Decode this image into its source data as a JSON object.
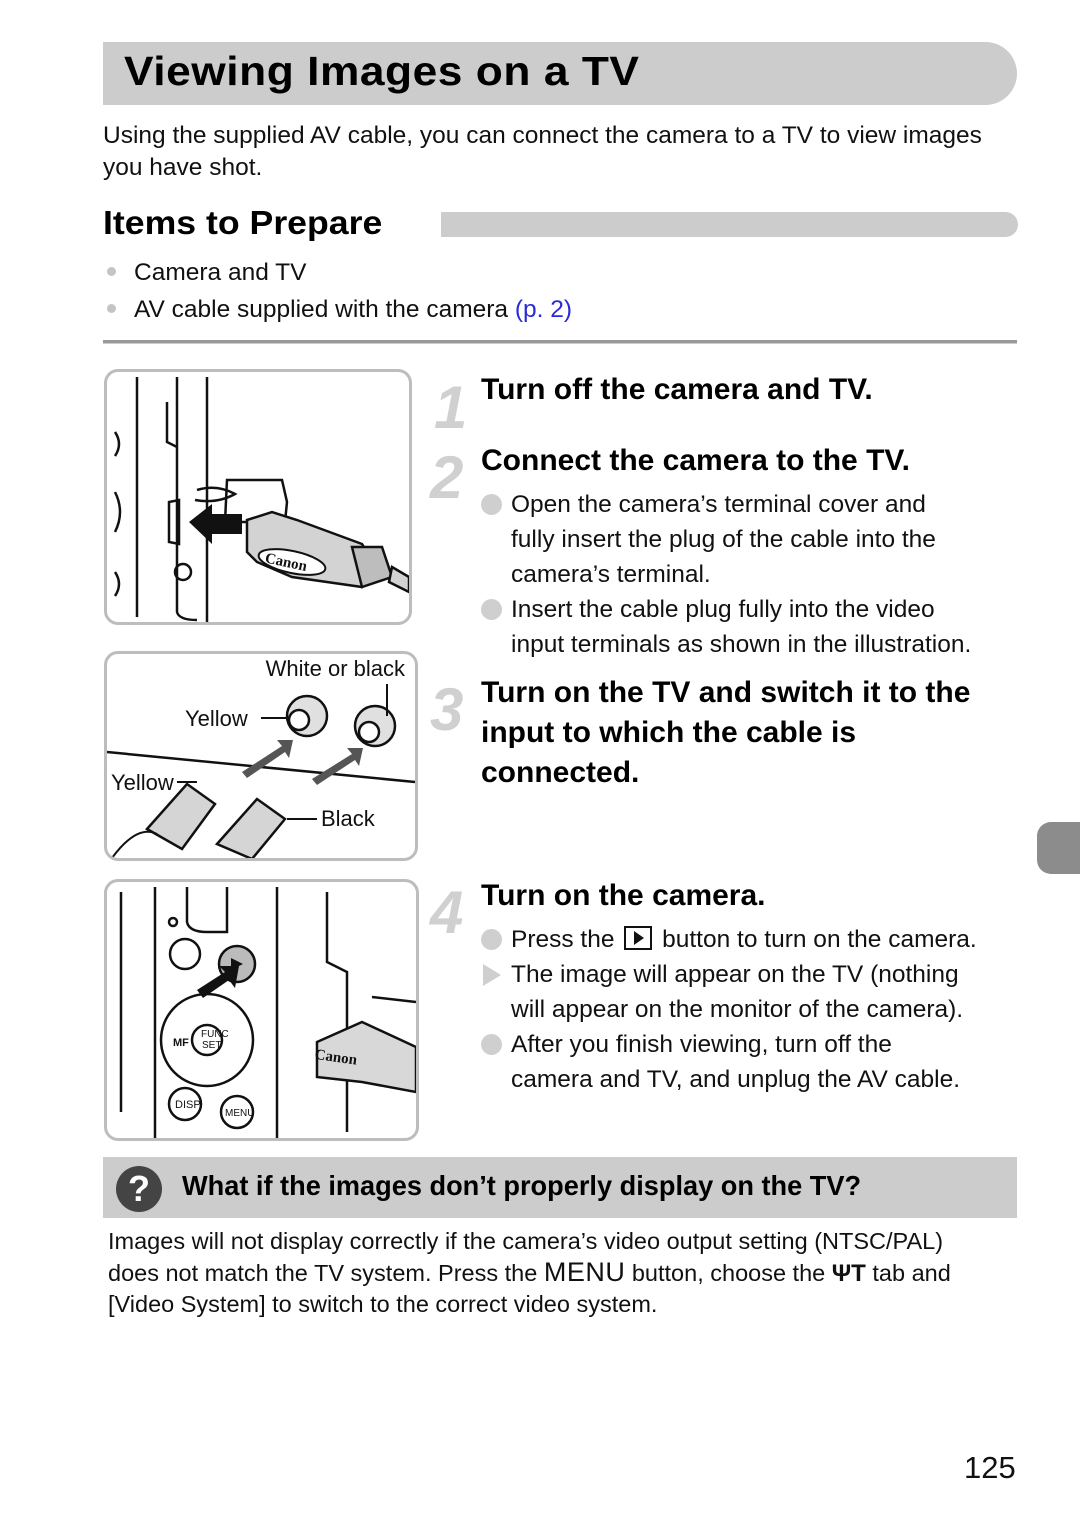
{
  "page": {
    "title": "Viewing Images on a TV",
    "intro": "Using the supplied AV cable, you can connect the camera to a TV to view images you have shot.",
    "page_number": "125"
  },
  "prepare": {
    "heading": "Items to Prepare",
    "items": [
      {
        "text": "Camera and TV",
        "link": ""
      },
      {
        "text": "AV cable supplied with the camera ",
        "link": "(p. 2)"
      }
    ]
  },
  "illustrations": {
    "cable_plug_brand": "Canon",
    "connectors": {
      "white_or_black": "White or black",
      "yellow_jack": "Yellow",
      "yellow_plug": "Yellow",
      "black_plug": "Black"
    },
    "camera_buttons": {
      "func_set_top": "FUNC",
      "func_set_bottom": "SET",
      "disp": "DISP.",
      "menu": "MENU",
      "mf": "MF",
      "brand": "Canon"
    }
  },
  "steps": [
    {
      "number": "1",
      "title": "Turn off the camera and TV.",
      "bullets": []
    },
    {
      "number": "2",
      "title": "Connect the camera to the TV.",
      "bullets": [
        {
          "type": "circle",
          "lines": [
            "Open the camera’s terminal cover and",
            "fully insert the plug of the cable into the",
            "camera’s terminal."
          ]
        },
        {
          "type": "circle",
          "lines": [
            "Insert the cable plug fully into the video",
            "input terminals as shown in the illustration."
          ]
        }
      ]
    },
    {
      "number": "3",
      "title_lines": [
        "Turn on the TV and switch it to the",
        "input to which the cable is",
        "connected."
      ],
      "bullets": []
    },
    {
      "number": "4",
      "title": "Turn on the camera.",
      "bullets": [
        {
          "type": "circle",
          "before": "Press the",
          "icon": "playback-button-icon",
          "after": "button to turn on the camera."
        },
        {
          "type": "arrow",
          "lines": [
            "The image will appear on the TV (nothing",
            "will appear on the monitor of the camera)."
          ]
        },
        {
          "type": "circle",
          "lines": [
            "After you finish viewing, turn off the",
            "camera and TV, and unplug the AV cable."
          ]
        }
      ]
    }
  ],
  "tip": {
    "icon": "question-icon",
    "title": "What if the images don’t properly display on the TV?",
    "body_line1": "Images will not display correctly if the camera’s video output setting (NTSC/PAL)",
    "body_line2_a": "does not match the TV system. Press the ",
    "menu_word": "MENU",
    "body_line2_b": " button, choose the ",
    "tab_icon": "ΨΤ",
    "body_line2_c": " tab and",
    "body_line3": "[Video System] to switch to the correct video system."
  },
  "colors": {
    "band_gray": "#cccccc",
    "link_blue": "#2a2ad8",
    "side_tab": "#8c8c8c",
    "step_number": "#d0d0d0"
  }
}
